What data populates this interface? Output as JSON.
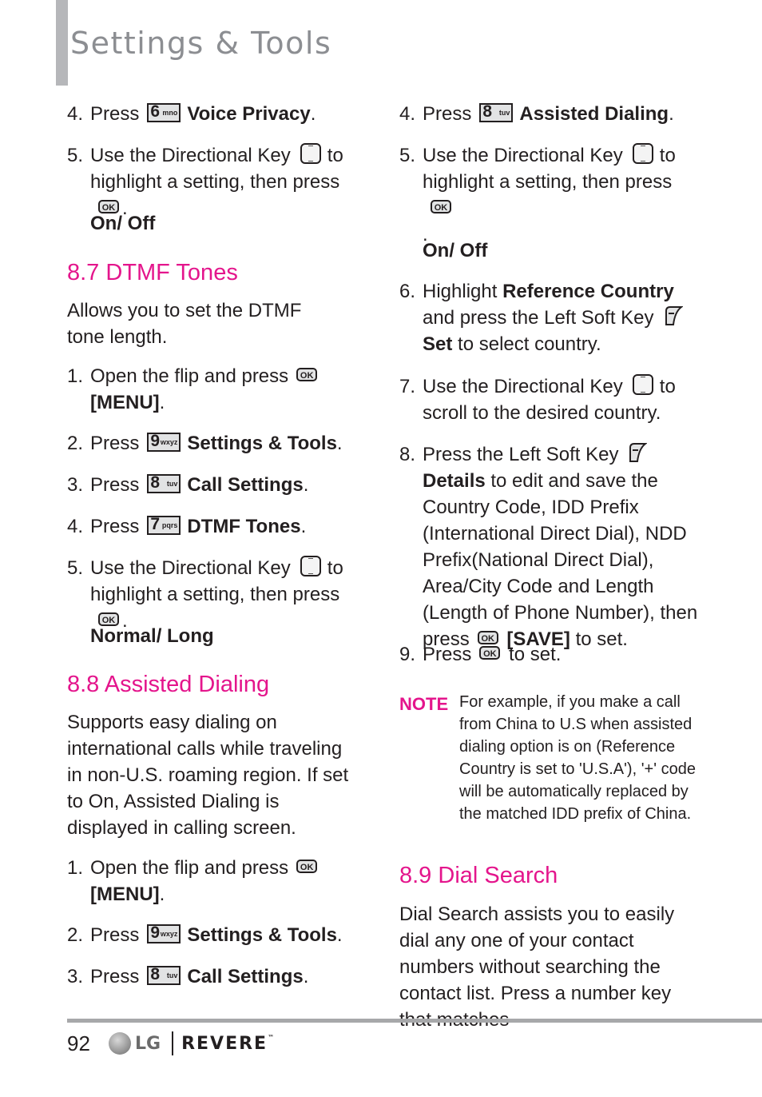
{
  "header": {
    "title": "Settings & Tools"
  },
  "left": {
    "intro_steps": [
      {
        "num": "4.",
        "pre": "Press",
        "key": {
          "digit": "6",
          "letters": "mno"
        },
        "label": "Voice Privacy",
        "post": "."
      },
      {
        "num": "5.",
        "text_a": "Use the Directional Key",
        "text_b": "to",
        "text_c": "highlight a setting, then press",
        "text_d": "."
      }
    ],
    "intro_options": "On/ Off",
    "dtmf": {
      "heading": "8.7 DTMF Tones",
      "desc": "Allows you to set the DTMF tone length.",
      "step1": {
        "num": "1.",
        "text": "Open the flip and press",
        "menu": "[MENU]",
        "post": "."
      },
      "step2": {
        "num": "2.",
        "pre": "Press",
        "key": {
          "digit": "9",
          "letters": "wxyz"
        },
        "label": "Settings & Tools",
        "post": "."
      },
      "step3": {
        "num": "3.",
        "pre": "Press",
        "key": {
          "digit": "8",
          "letters": "tuv"
        },
        "label": "Call Settings",
        "post": "."
      },
      "step4": {
        "num": "4.",
        "pre": "Press",
        "key": {
          "digit": "7",
          "letters": "pqrs"
        },
        "label": "DTMF Tones",
        "post": "."
      },
      "step5": {
        "num": "5.",
        "text_a": "Use the Directional Key",
        "text_b": "to",
        "text_c": "highlight a setting, then press",
        "text_d": "."
      },
      "options": "Normal/ Long"
    },
    "assisted": {
      "heading": "8.8 Assisted Dialing",
      "desc": "Supports easy dialing on international calls while traveling in non-U.S. roaming region. If set to On, Assisted Dialing is displayed in calling screen.",
      "step1": {
        "num": "1.",
        "text": "Open the flip and press",
        "menu": "[MENU]",
        "post": "."
      },
      "step2": {
        "num": "2.",
        "pre": "Press",
        "key": {
          "digit": "9",
          "letters": "wxyz"
        },
        "label": "Settings & Tools",
        "post": "."
      },
      "step3": {
        "num": "3.",
        "pre": "Press",
        "key": {
          "digit": "8",
          "letters": "tuv"
        },
        "label": "Call Settings",
        "post": "."
      }
    }
  },
  "right": {
    "step4": {
      "num": "4.",
      "pre": "Press",
      "key": {
        "digit": "8",
        "letters": "tuv"
      },
      "label": "Assisted Dialing",
      "post": "."
    },
    "step5": {
      "num": "5.",
      "text_a": "Use the Directional Key",
      "text_b": "to",
      "text_c": "highlight a setting, then press",
      "text_d": "."
    },
    "options": "On/ Off",
    "step6": {
      "num": "6.",
      "pre": "Highlight",
      "bold": "Reference Country",
      "text": "and press the Left Soft Key",
      "set": "Set",
      "post": "to select country."
    },
    "step7": {
      "num": "7.",
      "text_a": "Use the Directional Key",
      "text_b": "to",
      "text_c": "scroll to the desired country."
    },
    "step8": {
      "num": "8.",
      "pre": "Press the Left Soft Key",
      "bold": "Details",
      "body": "to edit and save the Country Code, IDD Prefix (International Direct Dial), NDD Prefix(National Direct Dial), Area/City Code and Length (Length of Phone Number), then",
      "press": "press",
      "save": "[SAVE]",
      "post": "to set."
    },
    "step9": {
      "num": "9.",
      "pre": "Press",
      "post": "to set."
    },
    "note": {
      "label": "NOTE",
      "text": "For example, if you make a call from China to U.S when assisted dialing option is on (Reference Country is set to 'U.S.A'), '+' code will be automatically replaced by the matched IDD prefix of China."
    },
    "dial_search": {
      "heading": "8.9 Dial Search",
      "desc": "Dial Search assists you to easily dial any one of your contact numbers without searching the contact list. Press a number key that matches"
    }
  },
  "footer": {
    "page_number": "92",
    "brand": "LG",
    "product": "REVERE",
    "tm": "™"
  },
  "icons": {
    "ok": "OK"
  },
  "colors": {
    "accent": "#e4158c",
    "title_gray": "#8c8e92",
    "bar_gray": "#b6b7ba"
  }
}
